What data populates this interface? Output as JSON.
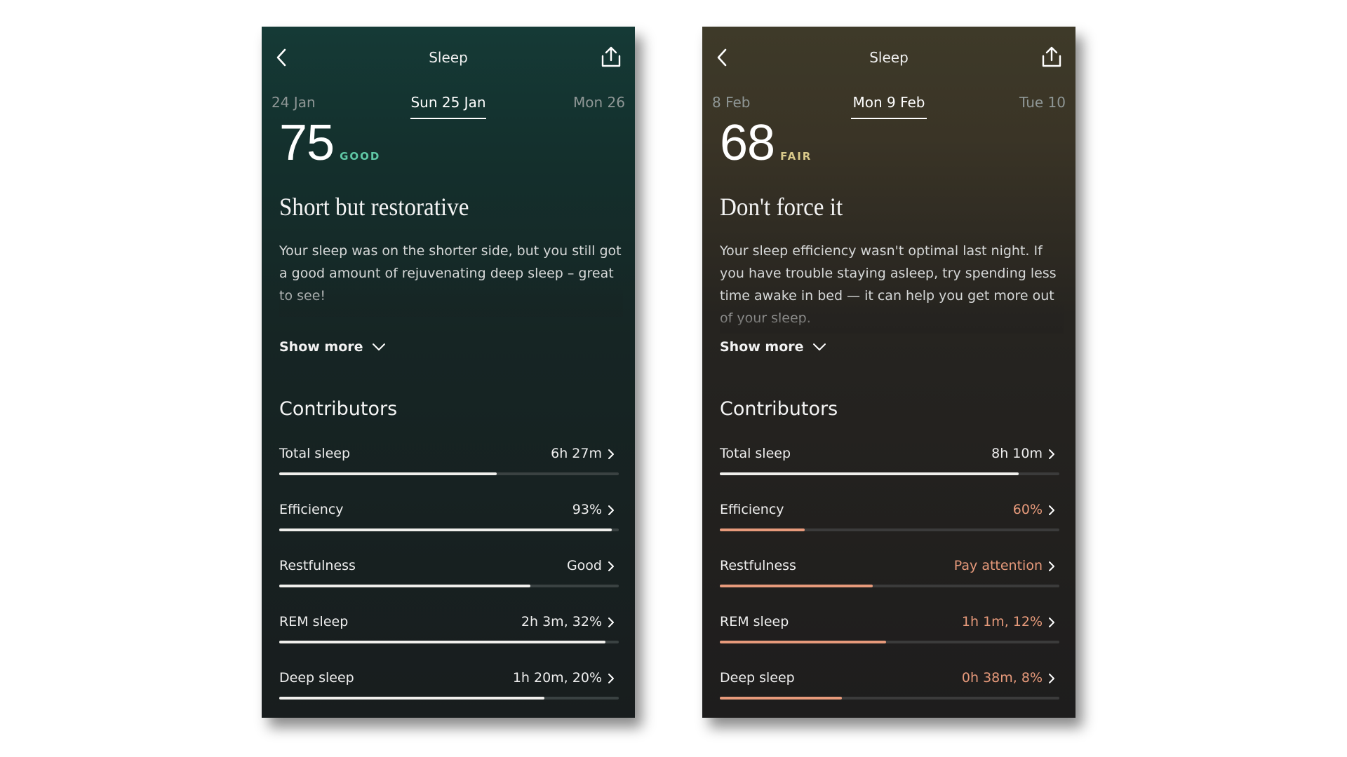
{
  "screens": [
    {
      "title": "Sleep",
      "dates": {
        "prev": "24 Jan",
        "current": "Sun 25 Jan",
        "next": "Mon 26"
      },
      "score": {
        "value": "75",
        "label": "GOOD"
      },
      "headline": "Short but restorative",
      "description": "Your sleep was on the shorter side, but you still got a good amount of rejuvenating deep sleep – great to see!",
      "show_more": "Show more",
      "contributors_title": "Contributors",
      "colors": {
        "score_label": "#5fc8a6",
        "value": "#eeeeee",
        "bar": "#f0efec"
      },
      "contributors": [
        {
          "name": "Total sleep",
          "value": "6h 27m",
          "level": 0.64,
          "status": "normal"
        },
        {
          "name": "Efficiency",
          "value": "93%",
          "level": 0.98,
          "status": "normal"
        },
        {
          "name": "Restfulness",
          "value": "Good",
          "level": 0.74,
          "status": "normal"
        },
        {
          "name": "REM sleep",
          "value": "2h 3m, 32%",
          "level": 0.96,
          "status": "normal"
        },
        {
          "name": "Deep sleep",
          "value": "1h 20m, 20%",
          "level": 0.78,
          "status": "normal"
        }
      ]
    },
    {
      "title": "Sleep",
      "dates": {
        "prev": "8 Feb",
        "current": "Mon 9 Feb",
        "next": "Tue 10"
      },
      "score": {
        "value": "68",
        "label": "FAIR"
      },
      "headline": "Don't force it",
      "description": "Your sleep efficiency wasn't optimal last night. If you have trouble staying asleep, try spending less time awake in bed — it can help you get more out of your sleep.",
      "show_more": "Show more",
      "contributors_title": "Contributors",
      "colors": {
        "score_label": "#d9c98a",
        "value": "#eeeeee",
        "bar": "#f0efec",
        "attention": "#e79a7b"
      },
      "contributors": [
        {
          "name": "Total sleep",
          "value": "8h 10m",
          "level": 0.88,
          "status": "normal"
        },
        {
          "name": "Efficiency",
          "value": "60%",
          "level": 0.25,
          "status": "attention"
        },
        {
          "name": "Restfulness",
          "value": "Pay attention",
          "level": 0.45,
          "status": "attention"
        },
        {
          "name": "REM sleep",
          "value": "1h 1m, 12%",
          "level": 0.49,
          "status": "attention"
        },
        {
          "name": "Deep sleep",
          "value": "0h 38m, 8%",
          "level": 0.36,
          "status": "attention"
        }
      ]
    }
  ]
}
